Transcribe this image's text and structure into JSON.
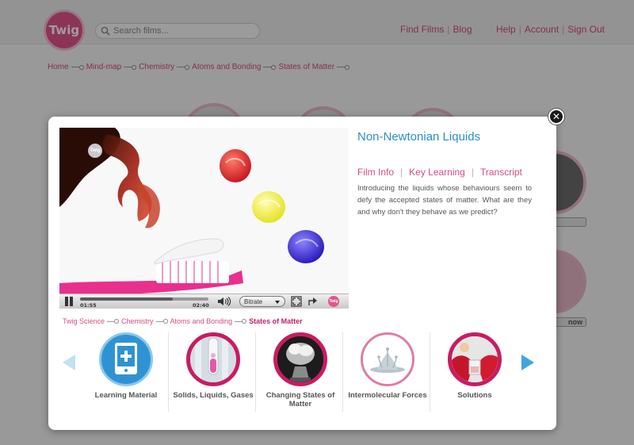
{
  "header": {
    "logo_text": "Twig",
    "search_placeholder": "Search films...",
    "links": {
      "find_films": "Find Films",
      "blog": "Blog",
      "help": "Help",
      "account": "Account",
      "sign_out": "Sign Out"
    }
  },
  "page_breadcrumb": [
    "Home",
    "Mind-map",
    "Chemistry",
    "Atoms and Bonding",
    "States of Matter"
  ],
  "background_pill_label": "now",
  "modal": {
    "close_glyph": "✕",
    "film_title": "Non-Newtonian Liquids",
    "tabs": [
      "Film Info",
      "Key Learning",
      "Transcript"
    ],
    "description": "Introducing the liquids whose behaviours seem to defy the accepted states of matter. What are they and why don't they behave as we predict?",
    "player": {
      "badge_text": "Twig",
      "elapsed": "01:55",
      "duration": "02:40",
      "progress_fraction": 0.72,
      "bitrate_label": "Bitrate"
    },
    "breadcrumb": [
      "Twig Science",
      "Chemistry",
      "Atoms and Bonding",
      "States of Matter"
    ],
    "carousel": [
      {
        "label": "Learning Material",
        "icon": "tablet-plus-icon"
      },
      {
        "label": "Solids, Liquids, Gases",
        "icon": "test-tube-thumbnail"
      },
      {
        "label": "Changing States of Matter",
        "icon": "flask-steam-thumbnail"
      },
      {
        "label": "Intermolecular Forces",
        "icon": "water-splash-thumbnail"
      },
      {
        "label": "Solutions",
        "icon": "lab-beaker-thumbnail"
      }
    ]
  },
  "colors": {
    "brand_pink": "#d64b84",
    "title_blue": "#2a8ec6",
    "toothbrush_pink": "#ea2f8d",
    "arrow_blue": "#3fa6e0"
  }
}
